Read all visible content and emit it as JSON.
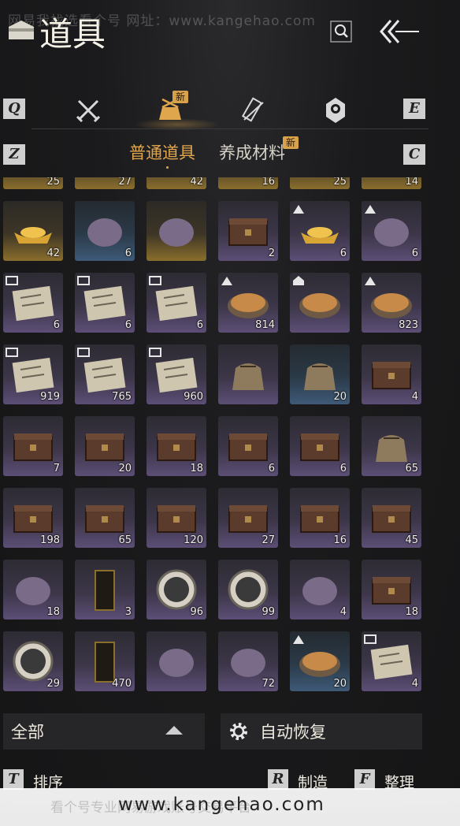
{
  "header": {
    "title": "道具",
    "watermark_top": "网易我找选看个号  网址：www.kangehao.com"
  },
  "tabs": {
    "left_key": "Q",
    "right_key": "E",
    "new_badge": "新",
    "items": [
      {
        "icon": "crossed-swords-icon"
      },
      {
        "icon": "pouch-icon",
        "active": true
      },
      {
        "icon": "scroll-sword-icon"
      },
      {
        "icon": "emblem-icon"
      }
    ]
  },
  "subtabs": {
    "left_key": "Z",
    "right_key": "C",
    "active_label": "普通道具",
    "inactive_label": "养成材料",
    "new_badge": "新"
  },
  "partial_row": [
    "25",
    "27",
    "42",
    "16",
    "25",
    "14"
  ],
  "grid": [
    [
      {
        "c": "42",
        "t": "gold",
        "i": "gold-ingot-icon"
      },
      {
        "c": "6",
        "t": "blue",
        "i": "spirit-wisp-icon"
      },
      {
        "c": "",
        "t": "gold",
        "i": "painting-scroll-icon"
      },
      {
        "c": "2",
        "t": "",
        "i": "chest-icon"
      },
      {
        "c": "6",
        "t": "",
        "i": "gold-pile-icon",
        "m": 1
      },
      {
        "c": "6",
        "t": "",
        "i": "gourd-icon",
        "m": 1
      }
    ],
    [
      {
        "c": "6",
        "t": "",
        "i": "letter-icon",
        "m": 2
      },
      {
        "c": "6",
        "t": "",
        "i": "letter-icon",
        "m": 2
      },
      {
        "c": "6",
        "t": "",
        "i": "letter-icon",
        "m": 2
      },
      {
        "c": "814",
        "t": "",
        "i": "stew-bowl-icon",
        "m": 1
      },
      {
        "c": "",
        "t": "",
        "i": "bun-bowl-icon",
        "m": 3
      },
      {
        "c": "823",
        "t": "",
        "i": "bun-bowl-icon",
        "m": 1
      }
    ],
    [
      {
        "c": "919",
        "t": "",
        "i": "letter-icon",
        "m": 2
      },
      {
        "c": "765",
        "t": "",
        "i": "letter-icon",
        "m": 2
      },
      {
        "c": "960",
        "t": "",
        "i": "letter-icon",
        "m": 2
      },
      {
        "c": "",
        "t": "",
        "i": "sack-icon"
      },
      {
        "c": "20",
        "t": "blue",
        "i": "cloth-bag-icon"
      },
      {
        "c": "4",
        "t": "",
        "i": "chest-icon"
      }
    ],
    [
      {
        "c": "7",
        "t": "",
        "i": "chest-icon"
      },
      {
        "c": "20",
        "t": "",
        "i": "chest-icon"
      },
      {
        "c": "18",
        "t": "",
        "i": "chest-icon"
      },
      {
        "c": "6",
        "t": "",
        "i": "chest-icon"
      },
      {
        "c": "6",
        "t": "",
        "i": "chest-icon"
      },
      {
        "c": "65",
        "t": "",
        "i": "sack-icon"
      }
    ],
    [
      {
        "c": "198",
        "t": "",
        "i": "ornate-chest-icon"
      },
      {
        "c": "65",
        "t": "",
        "i": "cabinet-icon"
      },
      {
        "c": "120",
        "t": "",
        "i": "cabinet-icon"
      },
      {
        "c": "27",
        "t": "",
        "i": "treasure-chest-icon"
      },
      {
        "c": "16",
        "t": "",
        "i": "iron-chest-icon"
      },
      {
        "c": "45",
        "t": "",
        "i": "wooden-chest-icon"
      }
    ],
    [
      {
        "c": "18",
        "t": "",
        "i": "jade-stone-icon"
      },
      {
        "c": "3",
        "t": "",
        "i": "token-plaque-icon"
      },
      {
        "c": "96",
        "t": "",
        "i": "crane-medal-icon"
      },
      {
        "c": "99",
        "t": "",
        "i": "crane-medal-icon"
      },
      {
        "c": "4",
        "t": "",
        "i": "orb-stand-icon"
      },
      {
        "c": "18",
        "t": "",
        "i": "dark-chest-icon"
      }
    ],
    [
      {
        "c": "29",
        "t": "",
        "i": "mountain-emblem-icon"
      },
      {
        "c": "470",
        "t": "",
        "i": "black-plaque-icon"
      },
      {
        "c": "",
        "t": "",
        "i": "jade-boxes-icon"
      },
      {
        "c": "72",
        "t": "",
        "i": "horn-icon"
      },
      {
        "c": "20",
        "t": "blue",
        "i": "meat-plate-icon",
        "m": 1
      },
      {
        "c": "4",
        "t": "",
        "i": "letter-icon",
        "m": 2
      }
    ]
  ],
  "footer": {
    "filter_label": "全部",
    "auto_restore_label": "自动恢复",
    "sort_key": "T",
    "sort_label": "排序",
    "craft_key": "R",
    "craft_label": "制造",
    "organize_key": "F",
    "organize_label": "整理"
  },
  "watermark_bottom": {
    "url": "www.kangehao.com",
    "faint": "看个号专业网易游戏账号交易平台"
  },
  "colors": {
    "accent": "#e0a64d",
    "rare_purple": "#5c4e76",
    "rare_gold": "#8a6e2c",
    "rare_blue": "#3e5a78"
  }
}
